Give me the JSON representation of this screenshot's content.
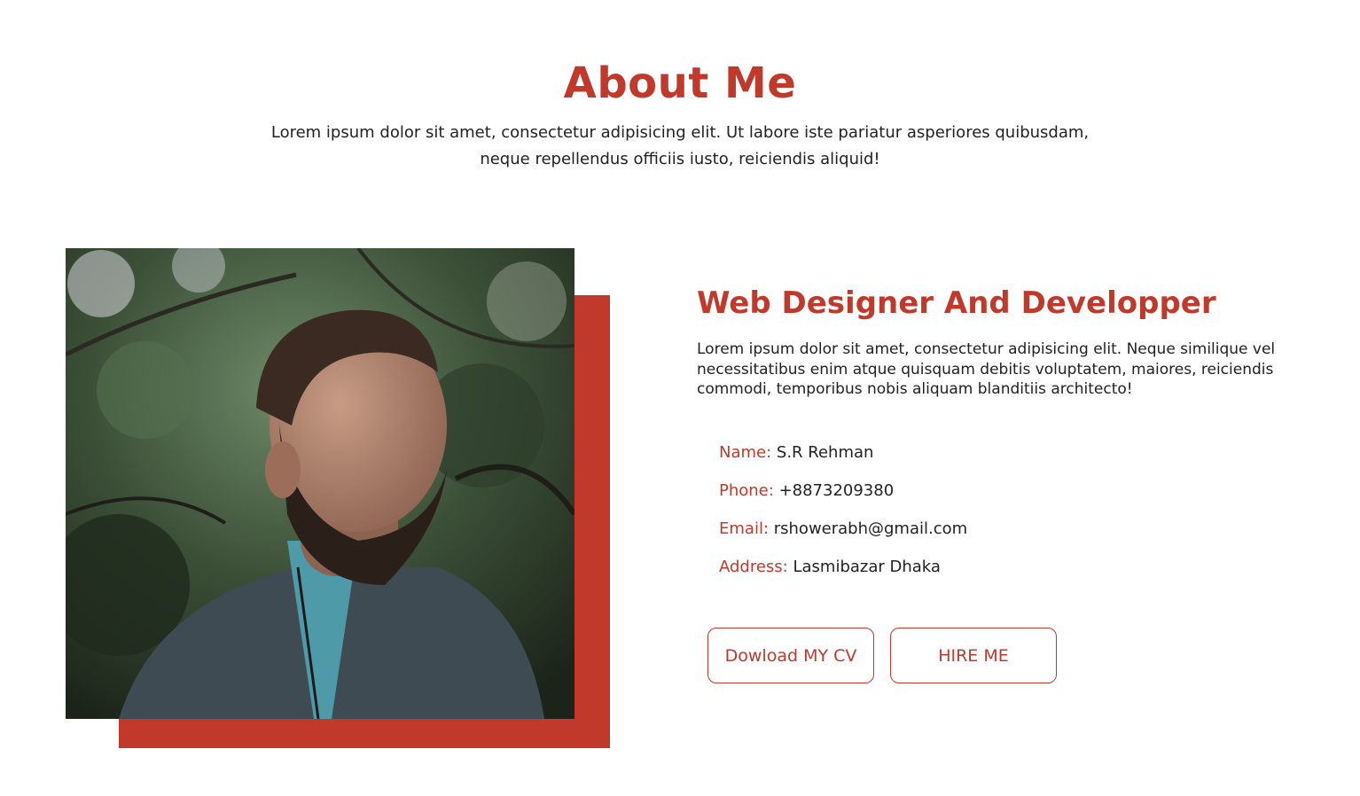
{
  "header": {
    "title": "About Me",
    "intro": "Lorem ipsum dolor sit amet, consectetur adipisicing elit. Ut labore iste pariatur asperiores quibusdam, neque repellendus officiis iusto, reiciendis aliquid!"
  },
  "profile": {
    "photo_icon": "portrait-photo",
    "role_title": "Web Designer And Developper",
    "description": "Lorem ipsum dolor sit amet, consectetur adipisicing elit. Neque similique vel necessitatibus enim atque quisquam debitis voluptatem, maiores, reiciendis commodi, temporibus nobis aliquam blanditiis architecto!",
    "info": [
      {
        "label": "Name:",
        "value": "S.R Rehman"
      },
      {
        "label": "Phone:",
        "value": "+8873209380"
      },
      {
        "label": "Email:",
        "value": "rshowerabh@gmail.com"
      },
      {
        "label": "Address:",
        "value": "Lasmibazar Dhaka"
      }
    ]
  },
  "actions": {
    "download_cv": "Dowload MY CV",
    "hire_me": "HIRE ME"
  },
  "colors": {
    "accent": "#c0392b",
    "text": "#222222",
    "background": "#ffffff"
  }
}
